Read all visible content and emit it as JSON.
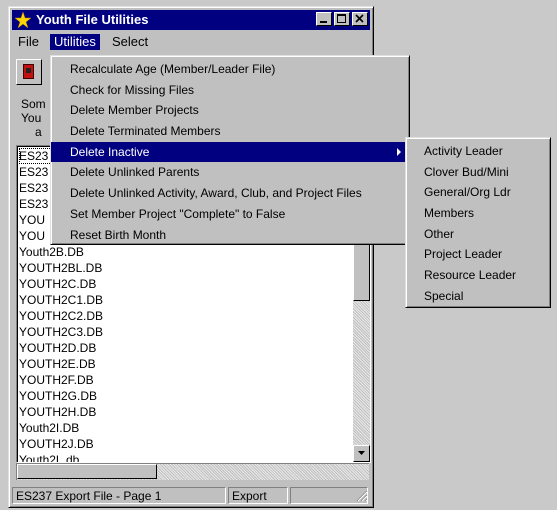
{
  "window": {
    "title": "Youth File Utilities",
    "title_icon": "sparkle-app-icon",
    "controls": [
      "minimize-icon",
      "maximize-icon",
      "close-icon"
    ]
  },
  "menubar": {
    "items": [
      {
        "label": "File"
      },
      {
        "label": "Utilities",
        "active": true
      },
      {
        "label": "Select"
      }
    ]
  },
  "toolbar": {
    "button_icon": "red-disk-icon"
  },
  "description": {
    "lines": [
      "Som",
      "You",
      "a"
    ]
  },
  "file_list": {
    "items": [
      "ES23",
      "ES23",
      "ES23",
      "ES23",
      "YOU",
      "YOU",
      "Youth2B.DB",
      "YOUTH2BL.DB",
      "YOUTH2C.DB",
      "YOUTH2C1.DB",
      "YOUTH2C2.DB",
      "YOUTH2C3.DB",
      "YOUTH2D.DB",
      "YOUTH2E.DB",
      "YOUTH2F.DB",
      "YOUTH2G.DB",
      "YOUTH2H.DB",
      "Youth2I.DB",
      "YOUTH2J.DB",
      "Youth2L.db"
    ]
  },
  "statusbar": {
    "panels": [
      "ES237 Export File - Page 1",
      "Export",
      ""
    ]
  },
  "utilities_menu": {
    "items": [
      {
        "label": "Recalculate Age  (Member/Leader File)"
      },
      {
        "label": "Check for Missing Files"
      },
      {
        "label": "Delete Member Projects"
      },
      {
        "label": "Delete Terminated Members"
      },
      {
        "label": "Delete Inactive",
        "selected": true,
        "has_submenu": true
      },
      {
        "label": "Delete Unlinked Parents"
      },
      {
        "label": "Delete Unlinked Activity, Award, Club, and Project Files"
      },
      {
        "label": "Set Member Project \"Complete\" to False"
      },
      {
        "label": "Reset Birth Month"
      }
    ]
  },
  "delete_inactive_submenu": {
    "items": [
      "Activity Leader",
      "Clover Bud/Mini",
      "General/Org Ldr",
      "Members",
      "Other",
      "Project Leader",
      "Resource Leader",
      "Special"
    ]
  },
  "colors": {
    "titlebar": "#000080",
    "menu_highlight": "#000080",
    "face": "#c0c0c0",
    "desktop": "#c9c9c9"
  }
}
